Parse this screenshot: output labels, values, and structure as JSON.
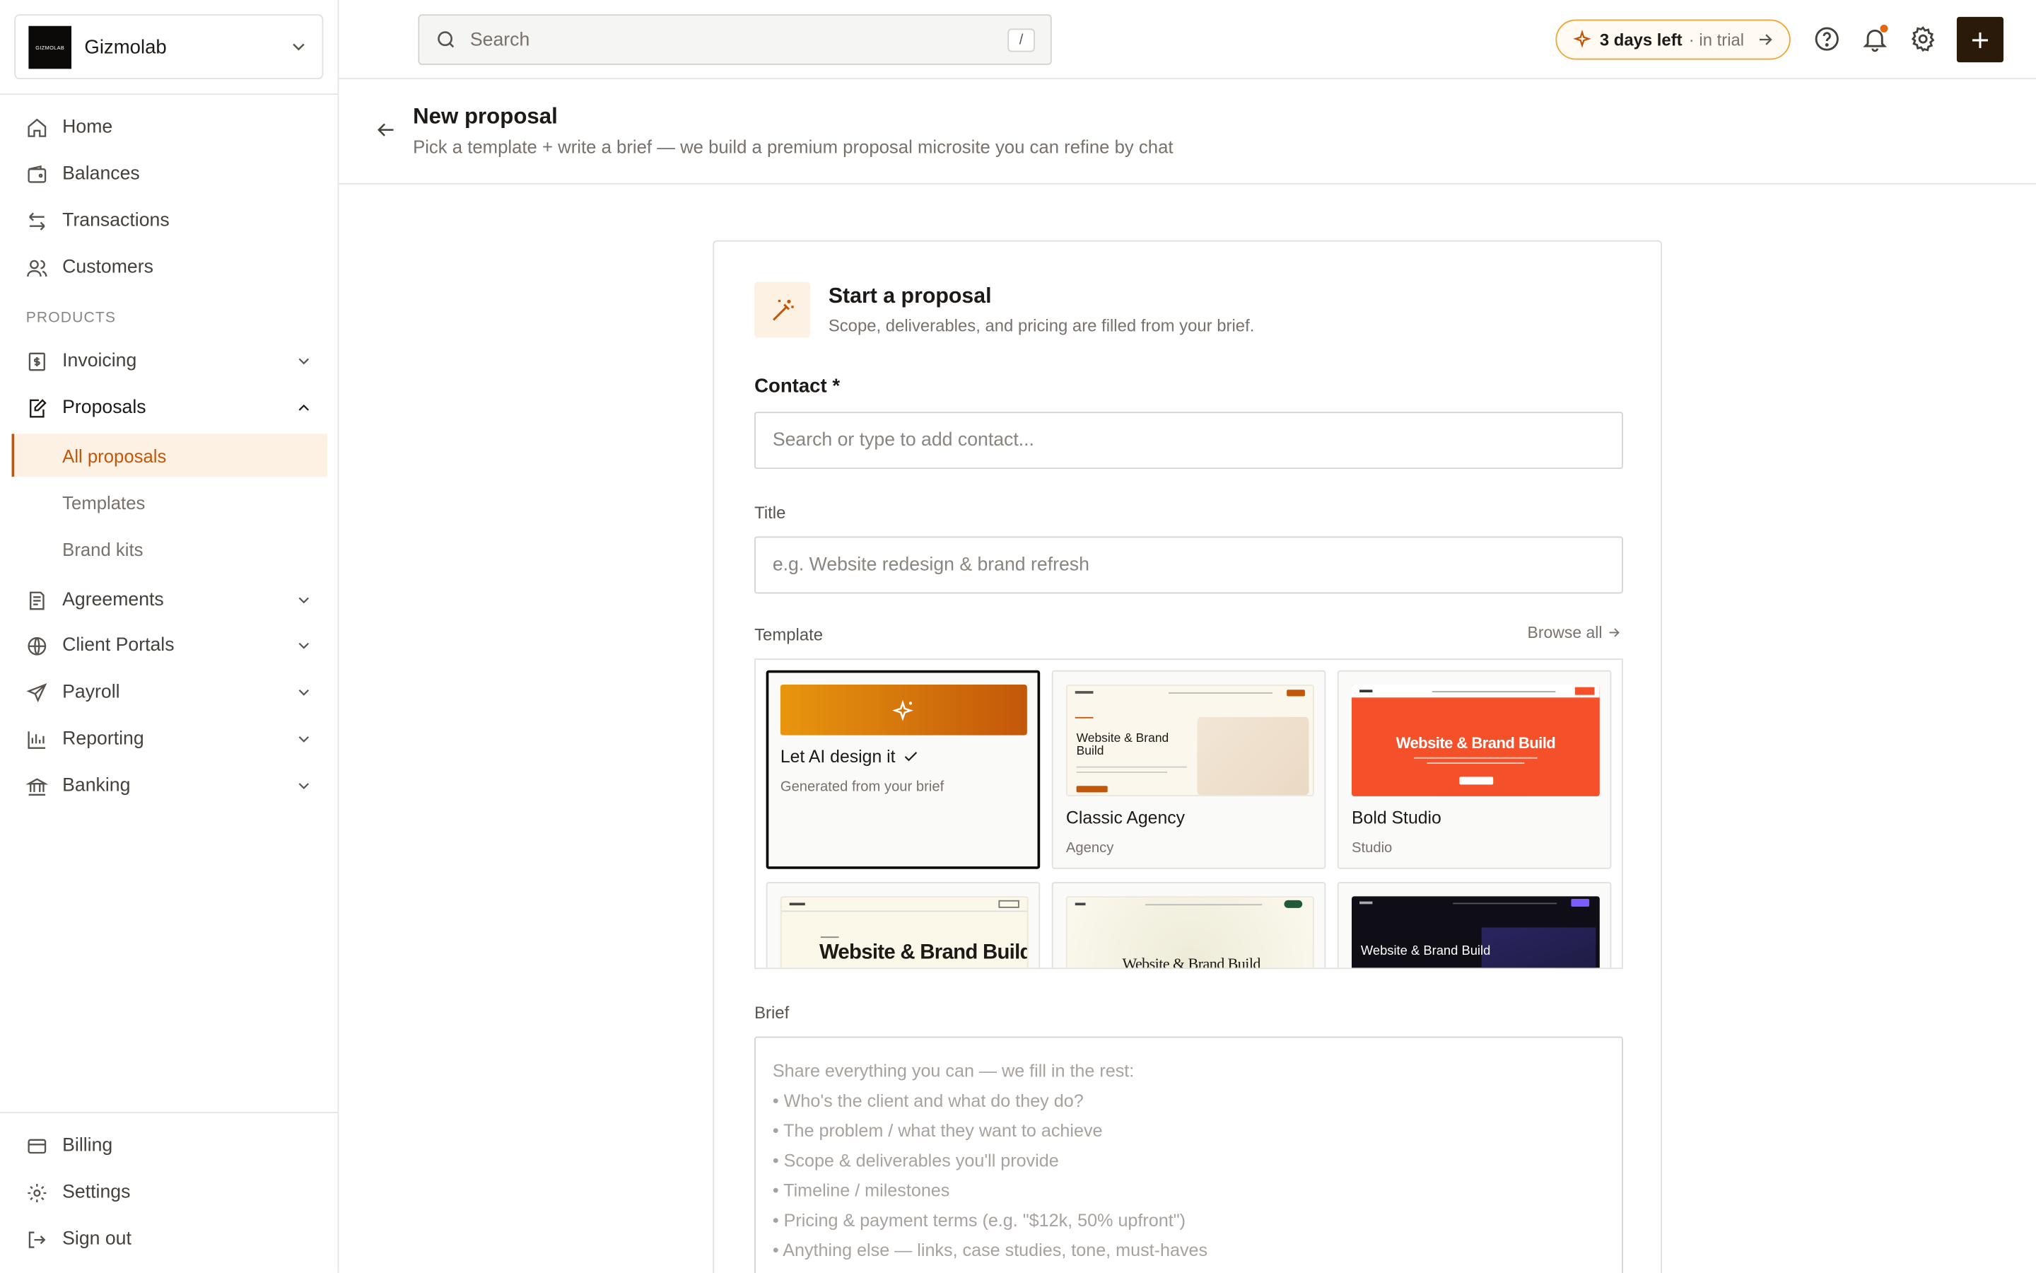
{
  "workspace": {
    "logo_text": "GIZMOLAB",
    "name": "Gizmolab"
  },
  "nav": {
    "main": [
      {
        "label": "Home",
        "icon": "home-icon"
      },
      {
        "label": "Balances",
        "icon": "wallet-icon"
      },
      {
        "label": "Transactions",
        "icon": "arrows-icon"
      },
      {
        "label": "Customers",
        "icon": "users-icon"
      }
    ],
    "section_products": "PRODUCTS",
    "products": [
      {
        "label": "Invoicing",
        "icon": "invoice-icon"
      },
      {
        "label": "Proposals",
        "icon": "proposal-icon"
      },
      {
        "label": "Agreements",
        "icon": "agreement-icon"
      },
      {
        "label": "Client Portals",
        "icon": "globe-icon"
      },
      {
        "label": "Payroll",
        "icon": "send-icon"
      },
      {
        "label": "Reporting",
        "icon": "chart-icon"
      },
      {
        "label": "Banking",
        "icon": "bank-icon"
      }
    ],
    "proposals_sub": [
      {
        "label": "All proposals",
        "active": true
      },
      {
        "label": "Templates"
      },
      {
        "label": "Brand kits"
      }
    ],
    "bottom": [
      {
        "label": "Billing",
        "icon": "card-icon"
      },
      {
        "label": "Settings",
        "icon": "gear-icon"
      },
      {
        "label": "Sign out",
        "icon": "signout-icon"
      }
    ]
  },
  "topbar": {
    "search_placeholder": "Search",
    "search_shortcut": "/",
    "trial_strong": "3 days left",
    "trial_muted": "· in trial"
  },
  "page": {
    "title": "New proposal",
    "subtitle": "Pick a template + write a brief — we build a premium proposal microsite you can refine by chat"
  },
  "card": {
    "title": "Start a proposal",
    "subtitle": "Scope, deliverables, and pricing are filled from your brief.",
    "contact_label": "Contact *",
    "contact_placeholder": "Search or type to add contact...",
    "title_label": "Title",
    "title_placeholder": "e.g. Website redesign & brand refresh",
    "template_label": "Template",
    "browse_all": "Browse all",
    "templates": [
      {
        "name": "Let AI design it",
        "category": "Generated from your brief",
        "selected": true
      },
      {
        "name": "Classic Agency",
        "category": "Agency",
        "thumb_title": "Website & Brand Build"
      },
      {
        "name": "Bold Studio",
        "category": "Studio",
        "thumb_title": "Website & Brand Build"
      },
      {
        "thumb_title": "Website & Brand Build"
      },
      {
        "thumb_title": "Website & Brand Build"
      },
      {
        "thumb_title": "Website & Brand Build"
      }
    ],
    "brief_label": "Brief",
    "brief_lines": [
      "Share everything you can — we fill in the rest:",
      "• Who's the client and what do they do?",
      "• The problem / what they want to achieve",
      "• Scope & deliverables you'll provide",
      "• Timeline / milestones",
      "• Pricing & payment terms (e.g. \"$12k, 50% upfront\")",
      "• Anything else — links, case studies, tone, must-haves"
    ]
  },
  "colors": {
    "accent": "#c2570a",
    "accent_bg": "#fdf1e4",
    "trial_border": "#f0a63a",
    "primary_dark": "#2a1a0a",
    "bold_studio_red": "#f4502a"
  }
}
